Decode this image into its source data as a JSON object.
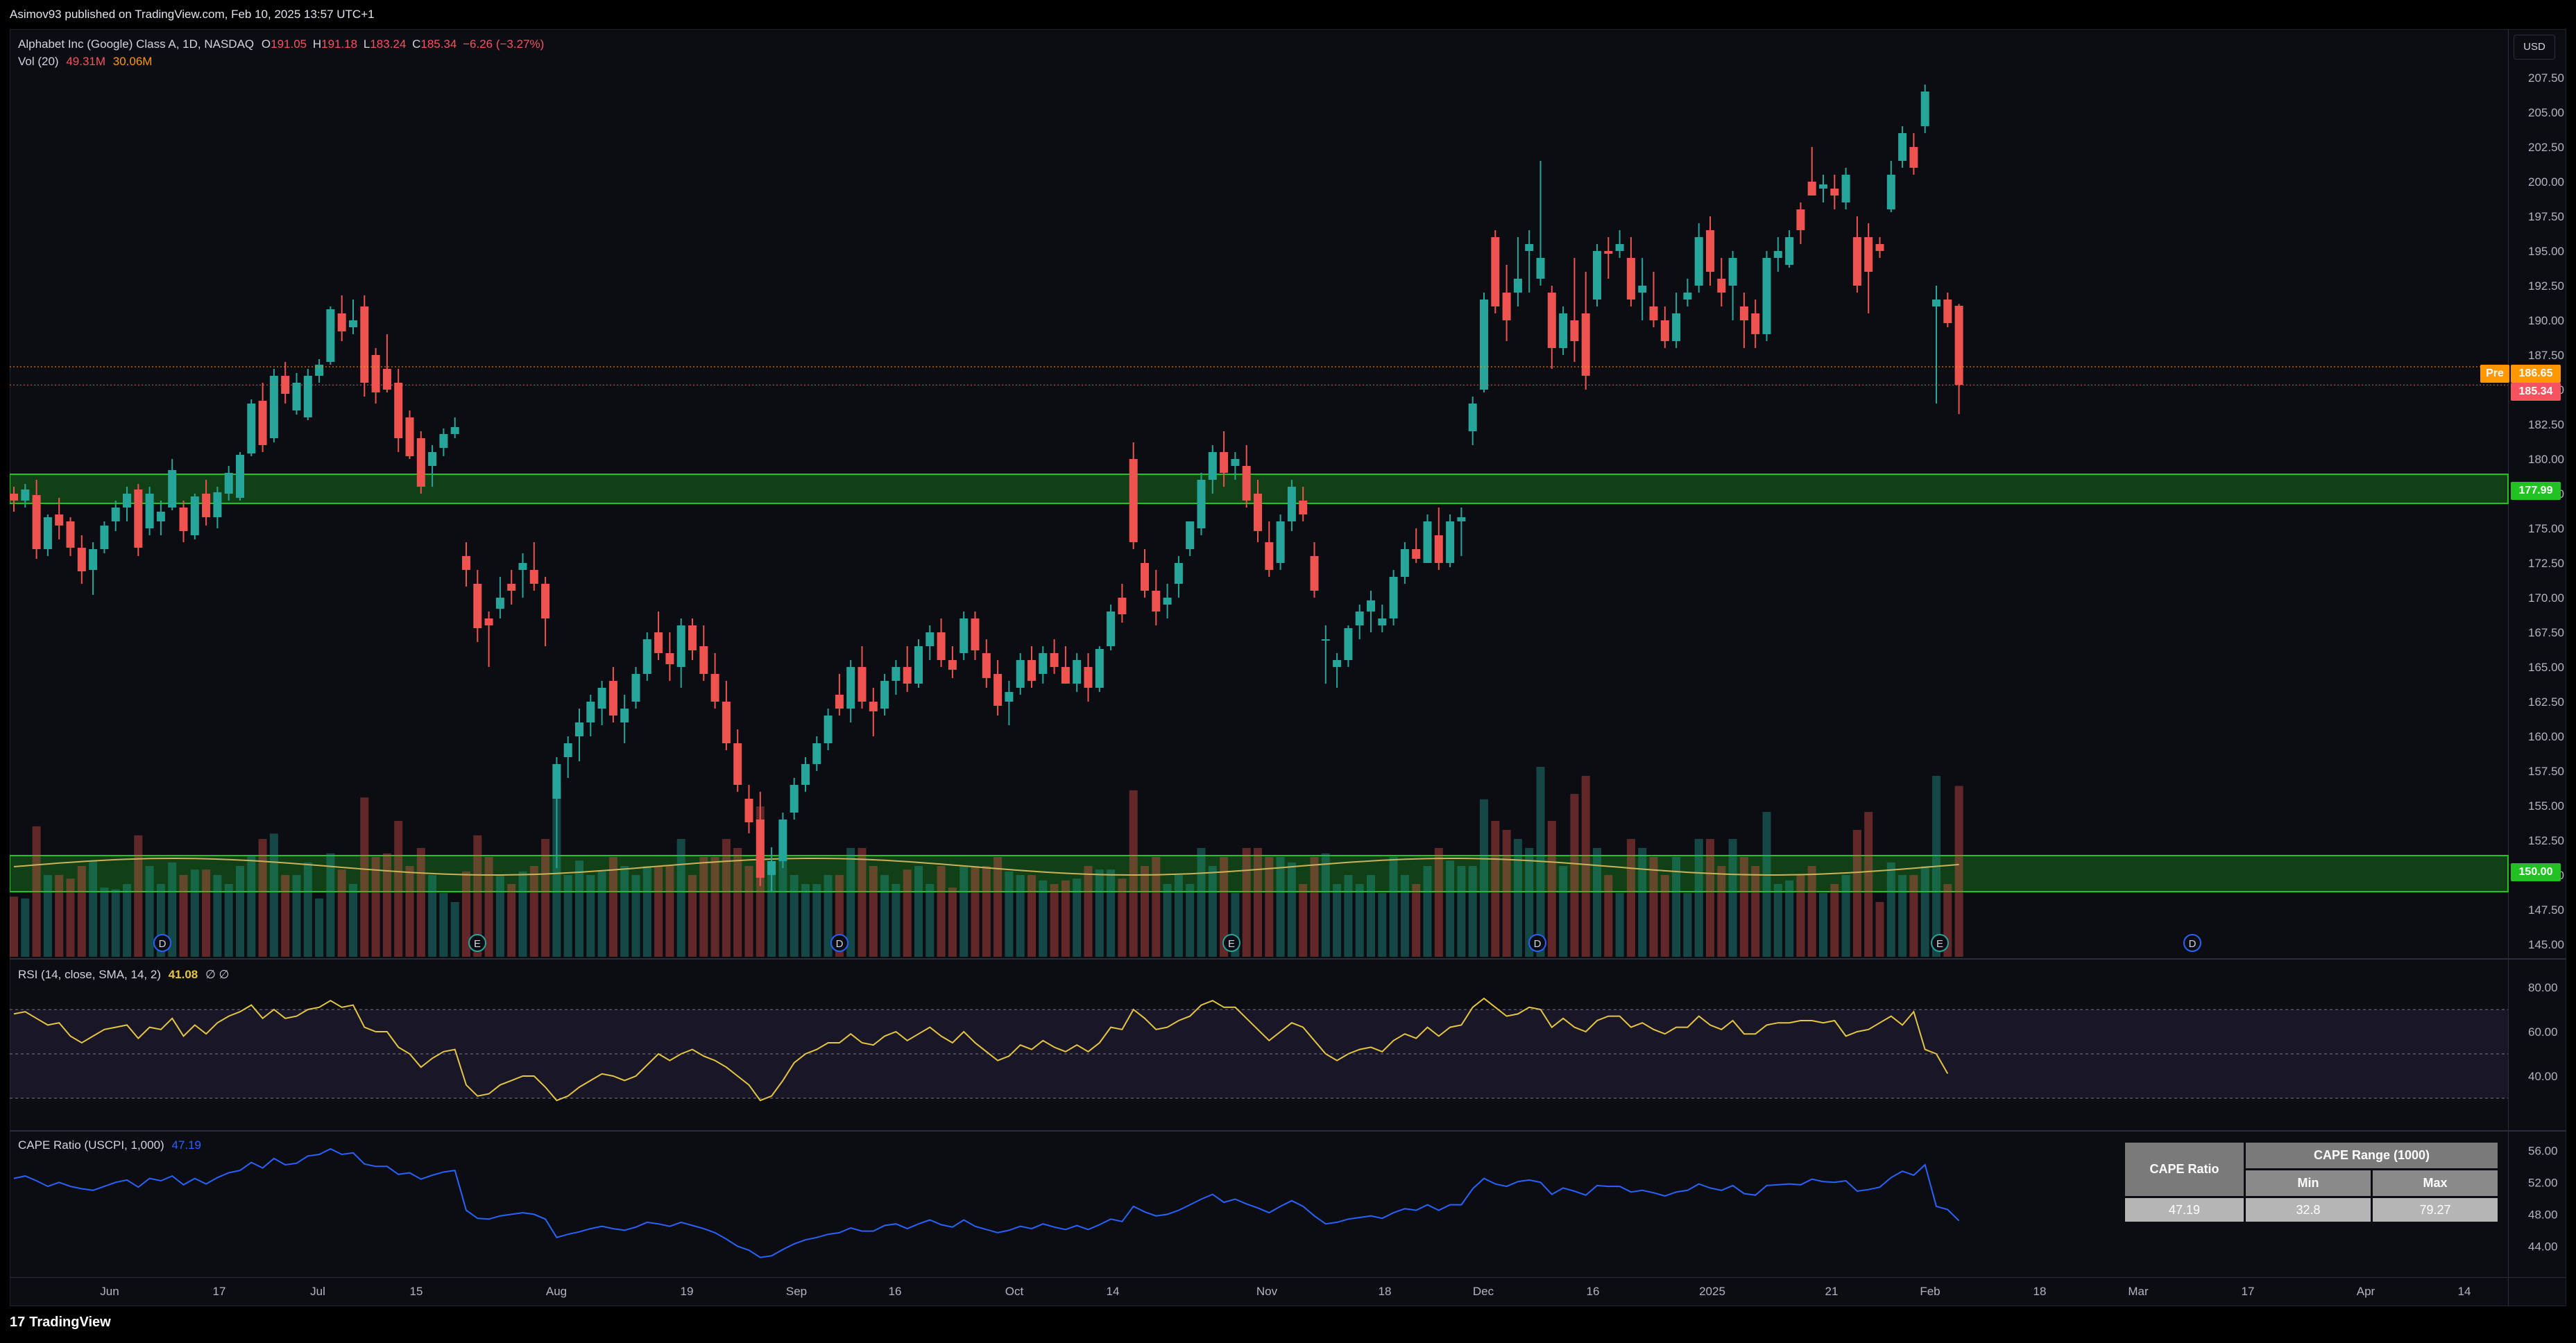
{
  "header": {
    "published": "Asimov93 published on TradingView.com, Feb 10, 2025 13:57 UTC+1"
  },
  "legend": {
    "symbol": "Alphabet Inc (Google) Class A, 1D, NASDAQ",
    "o_label": "O",
    "o": "191.05",
    "h_label": "H",
    "h": "191.18",
    "l_label": "L",
    "l": "183.24",
    "c_label": "C",
    "c": "185.34",
    "change": "−6.26 (−3.27%)",
    "vol_label": "Vol (20)",
    "vol1": "49.31M",
    "vol2": "30.06M",
    "rsi_label": "RSI (14, close, SMA, 14, 2)",
    "rsi_value": "41.08",
    "rsi_extra": "∅  ∅",
    "cape_label": "CAPE Ratio (USCPI, 1,000)",
    "cape_value": "47.19"
  },
  "currency": "USD",
  "price_tags": {
    "pre_label": "Pre",
    "pre": "186.65",
    "last": "185.34",
    "level_upper": "177.99",
    "level_lower": "150.00"
  },
  "colors": {
    "up": "#26a69a",
    "down": "#ef5350",
    "zone": "#22c222",
    "rsi_line": "#e5c643",
    "cape_line": "#2962ff",
    "vol_ma": "#c9b35a"
  },
  "footer": {
    "logo_text": "TradingView"
  },
  "cape_table": {
    "title": "CAPE Ratio",
    "range_title": "CAPE Range (1000)",
    "min_label": "Min",
    "max_label": "Max",
    "value": "47.19",
    "min": "32.8",
    "max": "79.27"
  },
  "chart_data": {
    "type": "candlestick",
    "title": "Alphabet Inc (Google) Class A, 1D, NASDAQ",
    "price_axis": {
      "ticks": [
        "207.50",
        "205.00",
        "202.50",
        "200.00",
        "197.50",
        "195.00",
        "192.50",
        "190.00",
        "187.50",
        "185.00",
        "182.50",
        "180.00",
        "177.50",
        "175.00",
        "172.50",
        "170.00",
        "167.50",
        "165.00",
        "162.50",
        "160.00",
        "157.50",
        "155.00",
        "152.50",
        "150.00",
        "147.50",
        "145.00"
      ],
      "ylim": [
        144.0,
        209.0
      ]
    },
    "time_axis": {
      "labels": [
        "Jun",
        "17",
        "Jul",
        "15",
        "Aug",
        "19",
        "Sep",
        "16",
        "Oct",
        "14",
        "Nov",
        "18",
        "Dec",
        "16",
        "2025",
        "21",
        "Feb",
        "18",
        "Mar",
        "17",
        "Apr",
        "14"
      ]
    },
    "rsi_axis": {
      "ticks": [
        "80.00",
        "60.00",
        "40.00"
      ],
      "upper_band": 70,
      "lower_band": 30,
      "mid": 50
    },
    "cape_axis": {
      "ticks": [
        "56.00",
        "52.00",
        "48.00",
        "44.00"
      ]
    },
    "zones": [
      {
        "low": 176.8,
        "high": 178.9,
        "label": "177.99"
      },
      {
        "low": 148.8,
        "high": 151.4,
        "label": "150.00"
      }
    ],
    "earnings_markers": [
      "E",
      "E",
      "E"
    ],
    "dividend_markers": [
      "D",
      "D",
      "D",
      "D"
    ],
    "candles": [
      [
        177.5,
        178.0,
        176.2,
        177.0
      ],
      [
        177.0,
        178.2,
        176.5,
        177.8
      ],
      [
        177.4,
        178.5,
        172.8,
        173.5
      ],
      [
        173.5,
        176.0,
        173.0,
        175.8
      ],
      [
        176.0,
        177.2,
        174.2,
        175.2
      ],
      [
        175.5,
        175.8,
        173.0,
        173.6
      ],
      [
        173.6,
        174.5,
        171.0,
        171.9
      ],
      [
        172.0,
        174.0,
        170.2,
        173.5
      ],
      [
        173.5,
        175.5,
        173.2,
        175.2
      ],
      [
        175.5,
        177.0,
        174.8,
        176.5
      ],
      [
        176.5,
        178.0,
        175.5,
        177.5
      ],
      [
        177.8,
        178.2,
        173.0,
        173.6
      ],
      [
        175.0,
        178.0,
        174.5,
        177.5
      ],
      [
        175.5,
        177.0,
        174.5,
        176.2
      ],
      [
        176.5,
        180.0,
        176.3,
        179.2
      ],
      [
        176.5,
        177.0,
        174.0,
        174.8
      ],
      [
        174.5,
        177.5,
        174.2,
        177.3
      ],
      [
        177.5,
        178.5,
        175.2,
        175.8
      ],
      [
        175.8,
        178.0,
        175.0,
        177.6
      ],
      [
        177.5,
        179.5,
        177.0,
        179.0
      ],
      [
        177.2,
        180.5,
        177.0,
        180.3
      ],
      [
        180.4,
        184.3,
        180.2,
        184.0
      ],
      [
        184.2,
        185.5,
        180.5,
        181.0
      ],
      [
        181.5,
        186.5,
        181.2,
        186.0
      ],
      [
        186.0,
        187.0,
        184.0,
        184.7
      ],
      [
        183.5,
        186.2,
        183.2,
        185.5
      ],
      [
        183.0,
        186.5,
        182.8,
        186.0
      ],
      [
        186.0,
        187.2,
        185.5,
        186.8
      ],
      [
        187.0,
        191.0,
        186.8,
        190.8
      ],
      [
        190.5,
        191.8,
        188.5,
        189.2
      ],
      [
        189.5,
        191.5,
        189.0,
        190.0
      ],
      [
        191.0,
        191.8,
        184.5,
        185.5
      ],
      [
        187.5,
        188.0,
        184.0,
        184.8
      ],
      [
        186.5,
        189.0,
        184.8,
        185.0
      ],
      [
        185.5,
        186.5,
        180.5,
        181.5
      ],
      [
        183.0,
        183.5,
        180.0,
        180.2
      ],
      [
        181.5,
        182.0,
        177.5,
        178.0
      ],
      [
        179.5,
        181.0,
        178.0,
        180.5
      ],
      [
        180.8,
        182.2,
        180.2,
        181.8
      ],
      [
        181.8,
        183.0,
        181.5,
        182.3
      ],
      [
        173.0,
        174.0,
        170.8,
        172.0
      ],
      [
        171.0,
        172.0,
        166.8,
        167.8
      ],
      [
        168.5,
        169.0,
        165.0,
        168.0
      ],
      [
        169.2,
        171.5,
        168.5,
        170.0
      ],
      [
        171.0,
        172.0,
        169.5,
        170.5
      ],
      [
        172.0,
        173.2,
        170.0,
        172.5
      ],
      [
        172.0,
        174.0,
        170.5,
        171.0
      ],
      [
        171.0,
        171.5,
        166.5,
        168.5
      ],
      [
        155.5,
        158.5,
        150.5,
        158.0
      ],
      [
        158.5,
        160.0,
        157.0,
        159.5
      ],
      [
        160.0,
        162.0,
        158.2,
        161.0
      ],
      [
        161.0,
        163.0,
        160.0,
        162.5
      ],
      [
        162.0,
        164.0,
        160.8,
        163.5
      ],
      [
        164.0,
        165.0,
        161.0,
        161.5
      ],
      [
        161.0,
        163.0,
        159.5,
        162.0
      ],
      [
        162.5,
        165.0,
        162.0,
        164.5
      ],
      [
        164.5,
        167.5,
        164.0,
        167.0
      ],
      [
        167.5,
        169.0,
        165.5,
        166.0
      ],
      [
        166.0,
        167.5,
        164.0,
        165.2
      ],
      [
        165.0,
        168.5,
        163.5,
        168.0
      ],
      [
        168.0,
        168.5,
        165.5,
        166.2
      ],
      [
        166.5,
        168.0,
        164.0,
        164.5
      ],
      [
        164.5,
        166.0,
        162.0,
        162.5
      ],
      [
        162.5,
        164.0,
        159.0,
        159.5
      ],
      [
        159.5,
        160.5,
        156.0,
        156.5
      ],
      [
        155.5,
        156.5,
        153.0,
        153.8
      ],
      [
        154.0,
        156.0,
        149.2,
        149.8
      ],
      [
        150.0,
        152.0,
        148.8,
        151.0
      ],
      [
        151.0,
        154.5,
        150.5,
        154.0
      ],
      [
        154.5,
        157.0,
        154.0,
        156.5
      ],
      [
        156.5,
        158.5,
        156.0,
        158.0
      ],
      [
        158.0,
        160.0,
        157.5,
        159.5
      ],
      [
        159.5,
        162.0,
        159.0,
        161.5
      ],
      [
        163.0,
        164.5,
        161.5,
        162.0
      ],
      [
        162.0,
        165.5,
        161.0,
        165.0
      ],
      [
        165.0,
        166.5,
        162.0,
        162.5
      ],
      [
        162.5,
        163.5,
        160.0,
        161.8
      ],
      [
        162.0,
        164.5,
        161.5,
        164.0
      ],
      [
        164.0,
        165.5,
        163.0,
        165.0
      ],
      [
        165.0,
        166.5,
        163.2,
        163.8
      ],
      [
        163.8,
        167.0,
        163.5,
        166.5
      ],
      [
        166.5,
        168.0,
        165.5,
        167.5
      ],
      [
        167.5,
        168.5,
        165.0,
        165.5
      ],
      [
        165.5,
        166.5,
        164.2,
        164.8
      ],
      [
        166.0,
        169.0,
        165.5,
        168.5
      ],
      [
        168.5,
        169.0,
        165.5,
        166.2
      ],
      [
        166.0,
        167.0,
        163.5,
        164.2
      ],
      [
        164.5,
        165.5,
        161.5,
        162.2
      ],
      [
        162.5,
        164.0,
        160.8,
        163.2
      ],
      [
        163.5,
        166.0,
        163.0,
        165.5
      ],
      [
        165.5,
        166.5,
        163.5,
        164.0
      ],
      [
        164.5,
        166.5,
        163.8,
        166.0
      ],
      [
        166.0,
        167.0,
        164.5,
        165.0
      ],
      [
        165.0,
        166.5,
        163.8,
        163.8
      ],
      [
        163.8,
        166.0,
        163.2,
        165.5
      ],
      [
        165.0,
        166.0,
        162.5,
        163.5
      ],
      [
        163.5,
        166.5,
        163.2,
        166.3
      ],
      [
        166.5,
        169.5,
        166.2,
        169.0
      ],
      [
        170.0,
        171.0,
        168.2,
        168.8
      ],
      [
        180.0,
        181.2,
        173.5,
        174.0
      ],
      [
        172.5,
        173.5,
        170.0,
        170.5
      ],
      [
        170.5,
        172.0,
        168.0,
        169.0
      ],
      [
        169.5,
        171.0,
        168.5,
        170.0
      ],
      [
        171.0,
        173.0,
        170.0,
        172.5
      ],
      [
        173.5,
        175.5,
        173.0,
        175.5
      ],
      [
        175.0,
        179.0,
        174.5,
        178.5
      ],
      [
        178.5,
        181.0,
        177.5,
        180.5
      ],
      [
        180.5,
        182.0,
        178.0,
        179.0
      ],
      [
        179.5,
        180.5,
        178.5,
        180.0
      ],
      [
        179.5,
        181.0,
        176.5,
        177.0
      ],
      [
        177.5,
        178.5,
        174.0,
        174.8
      ],
      [
        174.0,
        175.5,
        171.5,
        172.0
      ],
      [
        172.5,
        176.0,
        172.0,
        175.5
      ],
      [
        175.5,
        178.5,
        174.8,
        178.0
      ],
      [
        177.0,
        178.0,
        175.5,
        176.0
      ],
      [
        173.0,
        174.0,
        170.0,
        170.5
      ],
      [
        167.0,
        168.0,
        163.8,
        167.0
      ],
      [
        165.0,
        166.0,
        163.5,
        165.5
      ],
      [
        165.5,
        168.0,
        165.0,
        167.8
      ],
      [
        168.0,
        169.5,
        167.0,
        169.0
      ],
      [
        169.0,
        170.5,
        167.5,
        169.8
      ],
      [
        168.0,
        169.5,
        167.5,
        168.5
      ],
      [
        168.5,
        172.0,
        168.0,
        171.5
      ],
      [
        171.5,
        174.0,
        171.0,
        173.5
      ],
      [
        173.5,
        175.0,
        172.5,
        172.8
      ],
      [
        172.5,
        176.0,
        172.5,
        175.5
      ],
      [
        174.5,
        176.5,
        172.0,
        172.5
      ],
      [
        172.5,
        176.0,
        172.2,
        175.5
      ],
      [
        175.5,
        176.5,
        173.0,
        175.8
      ],
      [
        182.0,
        184.5,
        181.0,
        184.0
      ],
      [
        185.0,
        192.0,
        184.8,
        191.5
      ],
      [
        196.0,
        196.5,
        190.5,
        191.0
      ],
      [
        192.0,
        194.0,
        188.5,
        190.0
      ],
      [
        192.0,
        196.0,
        191.0,
        193.0
      ],
      [
        195.0,
        196.5,
        192.0,
        195.5
      ],
      [
        193.0,
        201.5,
        192.5,
        194.5
      ],
      [
        192.0,
        192.5,
        186.5,
        188.0
      ],
      [
        188.0,
        191.0,
        187.5,
        190.5
      ],
      [
        190.0,
        194.5,
        187.0,
        188.5
      ],
      [
        190.5,
        193.5,
        185.0,
        186.0
      ],
      [
        191.5,
        195.5,
        191.0,
        195.0
      ],
      [
        195.0,
        196.0,
        193.0,
        194.8
      ],
      [
        195.0,
        196.5,
        194.5,
        195.5
      ],
      [
        194.5,
        196.0,
        191.0,
        191.5
      ],
      [
        192.0,
        194.5,
        190.0,
        192.5
      ],
      [
        191.0,
        193.5,
        189.5,
        190.0
      ],
      [
        190.0,
        191.0,
        188.0,
        188.5
      ],
      [
        188.5,
        192.0,
        188.0,
        190.5
      ],
      [
        191.5,
        193.0,
        191.0,
        192.0
      ],
      [
        192.5,
        197.0,
        192.0,
        196.0
      ],
      [
        196.5,
        197.5,
        192.5,
        193.5
      ],
      [
        193.0,
        194.5,
        191.0,
        192.0
      ],
      [
        192.5,
        195.0,
        190.0,
        194.5
      ],
      [
        191.0,
        192.0,
        188.0,
        190.0
      ],
      [
        190.5,
        191.5,
        188.0,
        189.0
      ],
      [
        189.0,
        195.0,
        188.5,
        194.5
      ],
      [
        194.5,
        196.0,
        193.5,
        195.0
      ],
      [
        194.0,
        196.5,
        193.8,
        196.0
      ],
      [
        198.0,
        198.5,
        195.5,
        196.5
      ],
      [
        200.0,
        202.5,
        199.0,
        199.0
      ],
      [
        199.5,
        200.5,
        198.5,
        199.8
      ],
      [
        199.5,
        200.5,
        198.0,
        199.0
      ],
      [
        198.5,
        201.0,
        198.0,
        200.5
      ],
      [
        196.0,
        197.5,
        192.0,
        192.5
      ],
      [
        196.0,
        197.0,
        190.5,
        193.5
      ],
      [
        195.5,
        196.0,
        194.5,
        195.0
      ],
      [
        198.0,
        201.5,
        197.8,
        200.5
      ],
      [
        201.5,
        204.0,
        201.0,
        203.5
      ],
      [
        202.5,
        203.5,
        200.5,
        201.0
      ],
      [
        204.0,
        207.0,
        203.5,
        206.5
      ],
      [
        191.0,
        192.5,
        184.0,
        191.5
      ],
      [
        191.5,
        192.0,
        189.5,
        189.8
      ],
      [
        191.05,
        191.18,
        183.24,
        185.34
      ]
    ],
    "volume": {
      "label": "Vol (20)",
      "last": "49.31M",
      "ma": "30.06M"
    },
    "rsi": [
      68,
      69,
      66,
      63,
      64,
      58,
      55,
      58,
      61,
      62,
      63,
      57,
      62,
      61,
      66,
      58,
      63,
      59,
      64,
      67,
      69,
      72,
      66,
      70,
      66,
      67,
      70,
      71,
      74,
      71,
      72,
      62,
      60,
      60,
      53,
      50,
      44,
      48,
      51,
      52,
      36,
      31,
      32,
      36,
      38,
      40,
      40,
      35,
      29,
      31,
      35,
      38,
      41,
      40,
      38,
      40,
      45,
      50,
      47,
      50,
      52,
      49,
      47,
      44,
      40,
      36,
      29,
      31,
      38,
      46,
      50,
      52,
      55,
      55,
      59,
      55,
      54,
      58,
      60,
      56,
      59,
      62,
      58,
      55,
      60,
      55,
      51,
      47,
      49,
      54,
      52,
      56,
      53,
      51,
      54,
      51,
      55,
      62,
      61,
      70,
      66,
      61,
      62,
      65,
      67,
      72,
      74,
      71,
      71,
      66,
      61,
      56,
      60,
      64,
      62,
      56,
      50,
      47,
      50,
      52,
      53,
      51,
      56,
      59,
      57,
      62,
      58,
      62,
      63,
      71,
      75,
      71,
      67,
      68,
      71,
      70,
      62,
      66,
      62,
      60,
      65,
      67,
      67,
      62,
      64,
      61,
      59,
      62,
      62,
      67,
      63,
      61,
      65,
      59,
      59,
      63,
      64,
      64,
      65,
      65,
      64,
      65,
      58,
      60,
      61,
      64,
      67,
      63,
      69,
      52,
      50,
      41.08
    ],
    "cape": [
      52.5,
      52.8,
      52.2,
      51.5,
      52.0,
      51.5,
      51.2,
      51.0,
      51.5,
      52.0,
      52.3,
      51.4,
      52.5,
      52.2,
      52.8,
      51.7,
      52.5,
      51.8,
      52.6,
      53.2,
      53.5,
      54.5,
      53.8,
      55.0,
      54.2,
      54.4,
      55.3,
      55.5,
      56.2,
      55.5,
      55.7,
      54.3,
      54.0,
      54.0,
      53.0,
      53.2,
      52.4,
      52.9,
      53.3,
      53.5,
      48.5,
      47.5,
      47.4,
      47.8,
      48.0,
      48.2,
      48.0,
      47.4,
      45.1,
      45.5,
      45.8,
      46.2,
      46.5,
      46.2,
      46.0,
      46.4,
      47.0,
      46.8,
      46.5,
      47.0,
      46.6,
      46.2,
      45.7,
      44.9,
      44.0,
      43.5,
      42.6,
      42.8,
      43.6,
      44.3,
      44.8,
      45.1,
      45.5,
      45.7,
      46.3,
      45.9,
      45.9,
      46.6,
      46.8,
      46.2,
      46.8,
      47.3,
      46.7,
      46.4,
      47.3,
      46.5,
      46.1,
      45.7,
      46.0,
      46.5,
      46.2,
      46.8,
      46.4,
      46.1,
      46.6,
      46.1,
      46.7,
      47.4,
      47.1,
      49.0,
      48.3,
      47.8,
      48.0,
      48.5,
      49.2,
      49.9,
      50.5,
      49.5,
      49.9,
      49.3,
      48.8,
      48.2,
      49.0,
      49.7,
      49.0,
      47.8,
      46.8,
      47.0,
      47.4,
      47.6,
      47.8,
      47.5,
      48.2,
      48.7,
      48.5,
      49.2,
      48.5,
      49.2,
      49.2,
      51.2,
      52.5,
      51.8,
      51.5,
      52.1,
      52.3,
      52.0,
      50.5,
      51.3,
      50.9,
      50.4,
      51.6,
      51.5,
      51.5,
      50.8,
      51.0,
      50.7,
      50.3,
      50.8,
      51.0,
      51.8,
      51.3,
      51.0,
      51.6,
      50.6,
      50.4,
      51.6,
      51.7,
      51.8,
      51.7,
      52.4,
      52.1,
      52.0,
      52.2,
      50.9,
      51.1,
      51.4,
      52.6,
      53.4,
      52.9,
      54.2,
      49.0,
      48.6,
      47.19
    ]
  }
}
